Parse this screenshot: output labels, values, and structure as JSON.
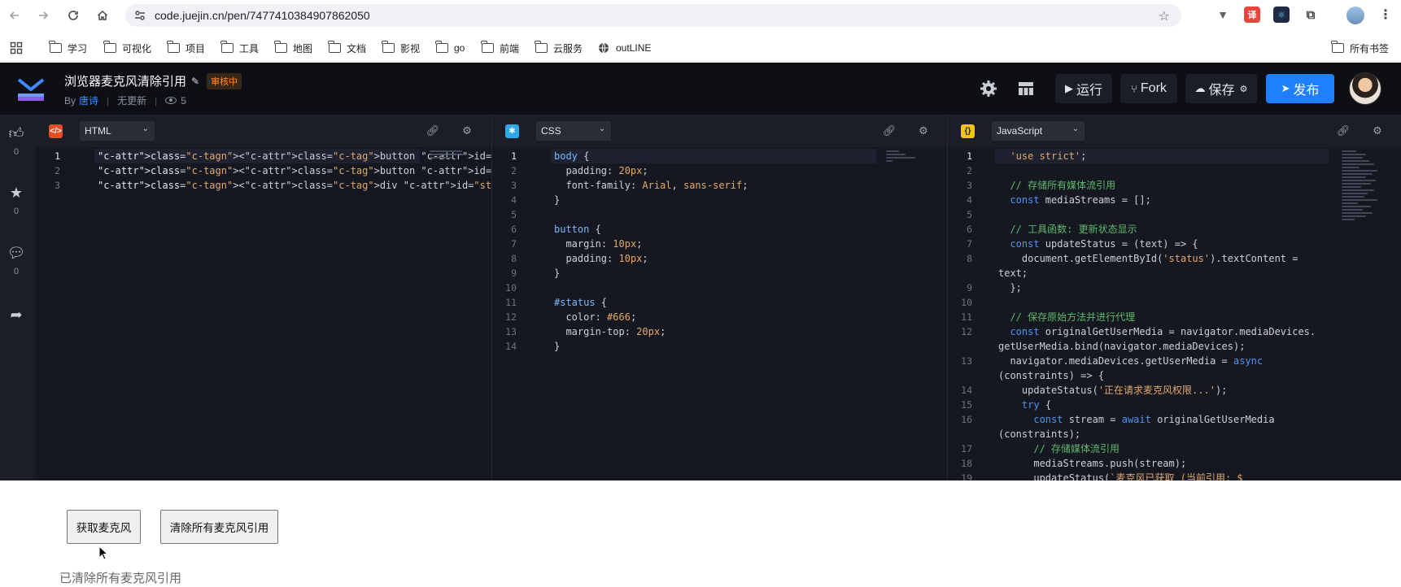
{
  "browser": {
    "url": "code.juejin.cn/pen/7477410384907862050",
    "bookmarks": [
      "学习",
      "可视化",
      "项目",
      "工具",
      "地图",
      "文档",
      "影视",
      "go",
      "前端",
      "云服务",
      "outLINE"
    ],
    "all_bookmarks": "所有书签"
  },
  "header": {
    "title": "浏览器麦克风清除引用",
    "status_badge": "审核中",
    "by_label": "By",
    "author": "唐诗",
    "update_status": "无更新",
    "views": "5",
    "run_label": "运行",
    "fork_label": "Fork",
    "save_label": "保存",
    "publish_label": "发布"
  },
  "rail": {
    "like_count": "0",
    "star_count": "0",
    "comment_count": "0"
  },
  "panes": {
    "html": {
      "lang": "HTML",
      "icon": "</>"
    },
    "css": {
      "lang": "CSS",
      "icon": "✱"
    },
    "js": {
      "lang": "JavaScript",
      "icon": "{}"
    }
  },
  "code": {
    "html_lines": [
      "<button id=\"getMicBtn\">获取麦克风</button>",
      "<button id=\"clearMicsBtn\">清除所有麦克风引用</button>",
      "<div id=\"status\">准备就绪</div>"
    ],
    "css_lines": [
      "body {",
      "  padding: 20px;",
      "  font-family: Arial, sans-serif;",
      "}",
      "",
      "button {",
      "  margin: 10px;",
      "  padding: 10px;",
      "}",
      "",
      "#status {",
      "  color: #666;",
      "  margin-top: 20px;",
      "}"
    ],
    "js_lines": [
      "  'use strict';",
      "",
      "  // 存储所有媒体流引用",
      "  const mediaStreams = [];",
      "",
      "  // 工具函数: 更新状态显示",
      "  const updateStatus = (text) => {",
      "    document.getElementById('status').textContent =",
      "text;",
      "  };",
      "",
      "  // 保存原始方法并进行代理",
      "  const originalGetUserMedia = navigator.mediaDevices.",
      "getUserMedia.bind(navigator.mediaDevices);",
      "  navigator.mediaDevices.getUserMedia = async",
      "(constraints) => {",
      "    updateStatus('正在请求麦克风权限...');",
      "    try {",
      "      const stream = await originalGetUserMedia",
      "(constraints);",
      "      // 存储媒体流引用",
      "      mediaStreams.push(stream);",
      "      updateStatus(`麦克风已获取 (当前引用: $"
    ],
    "js_line_numbers": [
      "1",
      "2",
      "3",
      "4",
      "5",
      "6",
      "7",
      "8",
      "",
      "9",
      "10",
      "11",
      "12",
      "",
      "13",
      "",
      "14",
      "15",
      "16",
      "",
      "17",
      "18",
      "19"
    ]
  },
  "preview": {
    "get_mic_label": "获取麦克风",
    "clear_label": "清除所有麦克风引用",
    "status_text": "已清除所有麦克风引用"
  },
  "colors": {
    "publish": "#1e80ff",
    "badge": "#ff8c2a",
    "header_bg": "#0d0f15"
  }
}
